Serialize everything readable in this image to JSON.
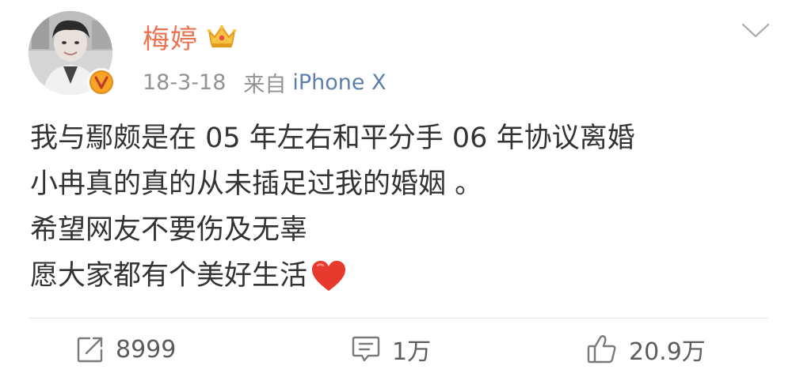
{
  "post": {
    "author": {
      "name": "梅婷",
      "avatar_icon": "avatar-photo",
      "verified_icon": "verified-v-badge-icon",
      "member_icon": "crown-icon"
    },
    "meta": {
      "date": "18-3-18",
      "source_prefix": "来自",
      "source_device": "iPhone X"
    },
    "menu_icon": "chevron-down-icon",
    "content": {
      "lines": [
        "我与鄢颇是在 05 年左右和平分手  06 年协议离婚",
        "小冉真的真的从未插足过我的婚姻 。",
        "希望网友不要伤及无辜",
        "愿大家都有个美好生活"
      ],
      "emoji": "red-heart-icon"
    },
    "actions": {
      "repost": {
        "icon": "repost-icon",
        "count": "8999"
      },
      "comment": {
        "icon": "comment-icon",
        "count": "1万"
      },
      "like": {
        "icon": "thumbs-up-icon",
        "count": "20.9万"
      }
    },
    "colors": {
      "username": "#eb7350",
      "meta": "#939393",
      "source_link": "#5b7fa8",
      "body_text": "#333333",
      "heart": "#e8392f",
      "badge": "#f5a623"
    }
  }
}
